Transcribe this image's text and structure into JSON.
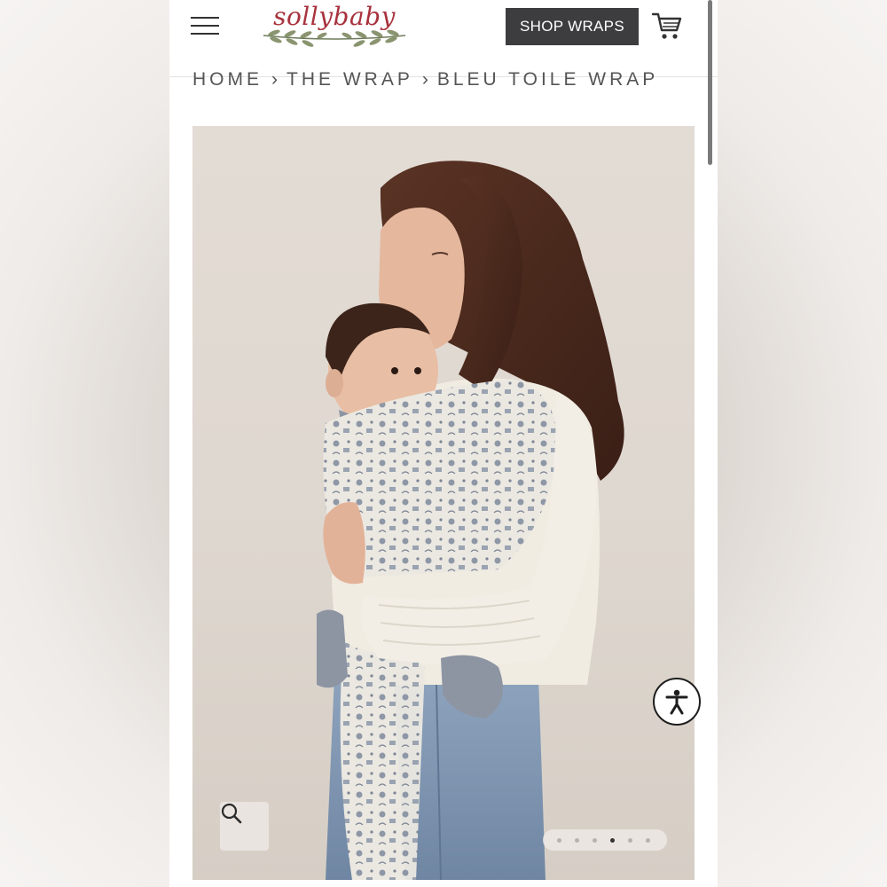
{
  "header": {
    "menu_icon": "hamburger-menu-icon",
    "logo_text": "sollybaby",
    "shop_button_label": "SHOP WRAPS",
    "cart_icon": "shopping-cart-icon"
  },
  "breadcrumb": {
    "items": [
      "HOME",
      "THE WRAP",
      "BLEU TOILE WRAP"
    ],
    "separator": "›"
  },
  "product_gallery": {
    "image_alt": "Mother wearing baby in Bleu Toile Wrap",
    "zoom_icon": "magnifier-icon",
    "slide_count": 6,
    "active_slide": 4
  },
  "accessibility": {
    "icon": "accessibility-person-icon"
  },
  "colors": {
    "brand_red": "#a8323d",
    "button_dark": "#3d3d3f",
    "text_gray": "#555555"
  }
}
